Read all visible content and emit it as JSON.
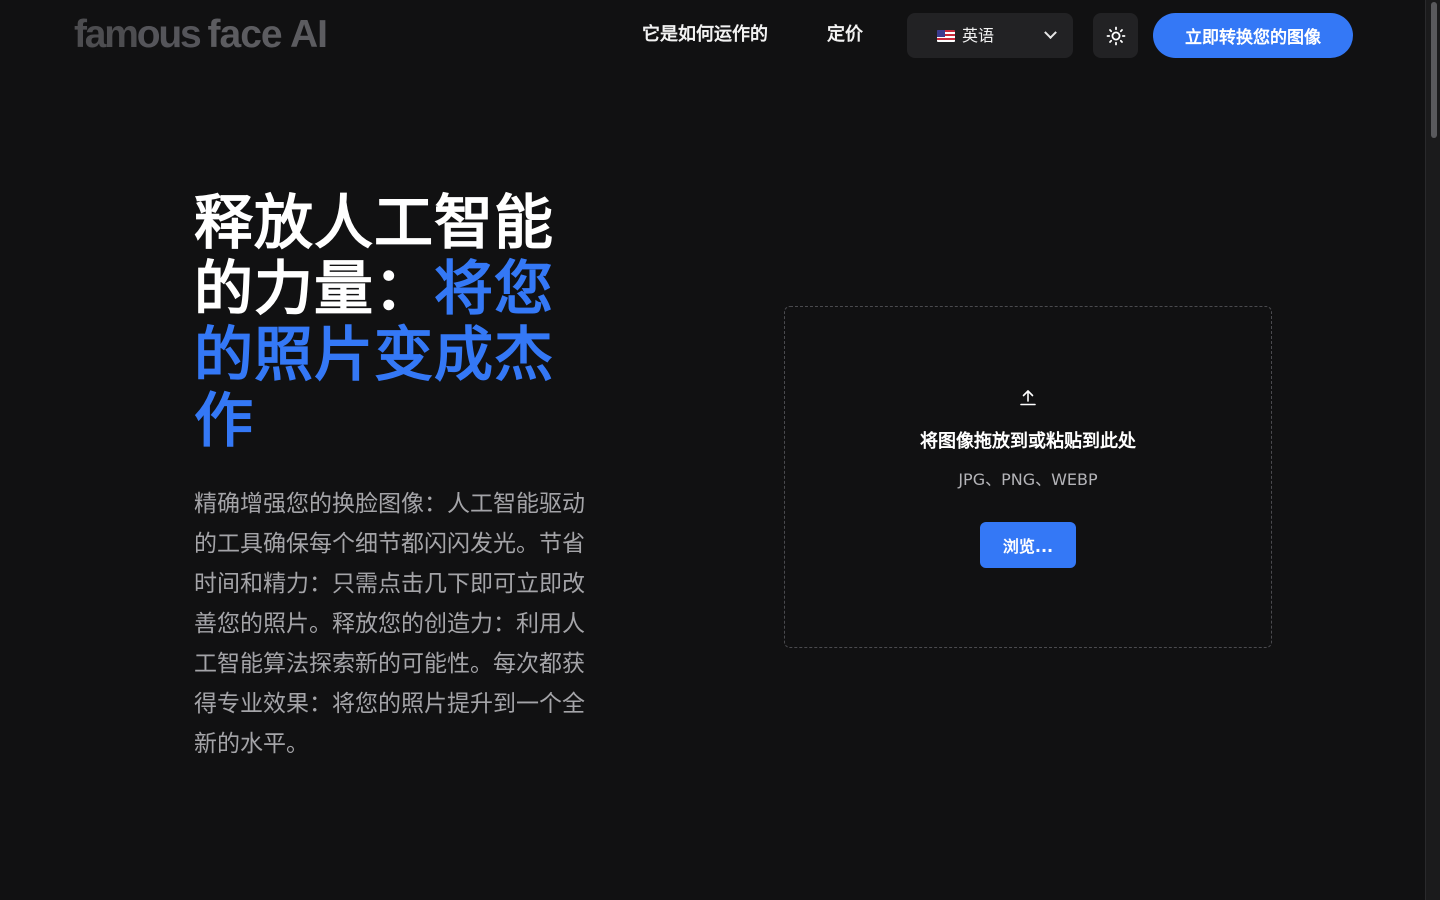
{
  "header": {
    "logo": {
      "part1": "fam",
      "part2": "ous",
      "part3": "face AI"
    },
    "nav": {
      "how_it_works": "它是如何运作的",
      "pricing": "定价"
    },
    "language": {
      "selected": "英语",
      "flag_icon": "us-flag-icon"
    },
    "theme_toggle_icon": "sun-icon",
    "cta_label": "立即转换您的图像"
  },
  "hero": {
    "title_line1": "释放人工智能的力量：",
    "title_accent": "将您的照片变成杰作",
    "description": "精确增强您的换脸图像：人工智能驱动的工具确保每个细节都闪闪发光。节省时间和精力：只需点击几下即可立即改善您的照片。释放您的创造力：利用人工智能算法探索新的可能性。每次都获得专业效果：将您的照片提升到一个全新的水平。"
  },
  "upload": {
    "icon": "upload-icon",
    "title": "将图像拖放到或粘贴到此处",
    "formats": "JPG、PNG、WEBP",
    "browse_label": "浏览..."
  },
  "colors": {
    "background": "#111112",
    "accent": "#3478f6",
    "muted_text": "#a4a4a8",
    "control_bg": "#222224"
  }
}
